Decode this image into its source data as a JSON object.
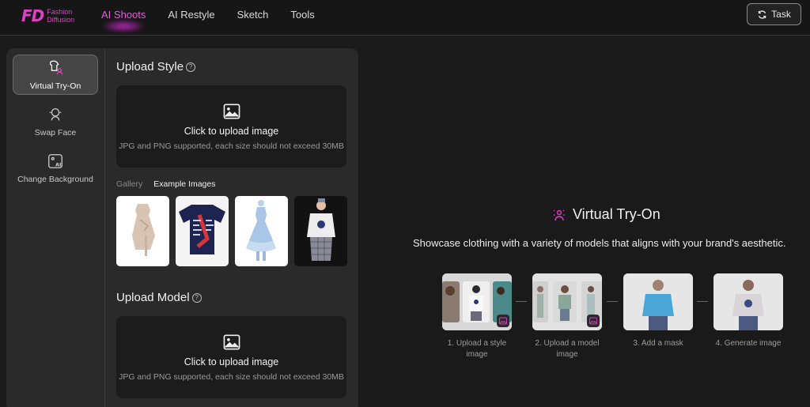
{
  "brand": {
    "mark": "FD",
    "line1": "Fashion",
    "line2": "Diffusion"
  },
  "nav": {
    "items": [
      {
        "label": "AI Shoots"
      },
      {
        "label": "AI Restyle"
      },
      {
        "label": "Sketch"
      },
      {
        "label": "Tools"
      }
    ],
    "active_index": 0
  },
  "task_button": {
    "label": "Task",
    "icon": "refresh-icon"
  },
  "tools": [
    {
      "label": "Virtual Try-On",
      "icon": "shirt-person-icon",
      "active": true
    },
    {
      "label": "Swap Face",
      "icon": "face-swap-icon",
      "active": false
    },
    {
      "label": "Change Background",
      "icon": "ai-image-icon",
      "active": false
    }
  ],
  "upload_style": {
    "title": "Upload Style",
    "help": "?",
    "label": "Click to upload image",
    "hint": "JPG and PNG supported, each size should not exceed 30MB"
  },
  "gallery_tabs": [
    {
      "label": "Gallery",
      "active": false
    },
    {
      "label": "Example Images",
      "active": true
    }
  ],
  "example_images": [
    {
      "name": "beige-dress"
    },
    {
      "name": "navy-graphic-tee"
    },
    {
      "name": "light-blue-ruffle-dress"
    },
    {
      "name": "model-white-hoodie"
    }
  ],
  "upload_model": {
    "title": "Upload Model",
    "help": "?",
    "label": "Click to upload image",
    "hint": "JPG and PNG supported, each size should not exceed 30MB"
  },
  "hero": {
    "title": "Virtual Try-On",
    "subtitle": "Showcase clothing with a variety of models that aligns with your brand's aesthetic."
  },
  "steps": [
    {
      "line1": "1. Upload a style",
      "line2": "image"
    },
    {
      "line1": "2. Upload a model",
      "line2": "image"
    },
    {
      "line1": "3. Add a mask",
      "line2": ""
    },
    {
      "line1": "4. Generate image",
      "line2": ""
    }
  ],
  "colors": {
    "accent": "#e040c8",
    "background": "#1a1a1a",
    "panel": "#2a2a2a"
  }
}
